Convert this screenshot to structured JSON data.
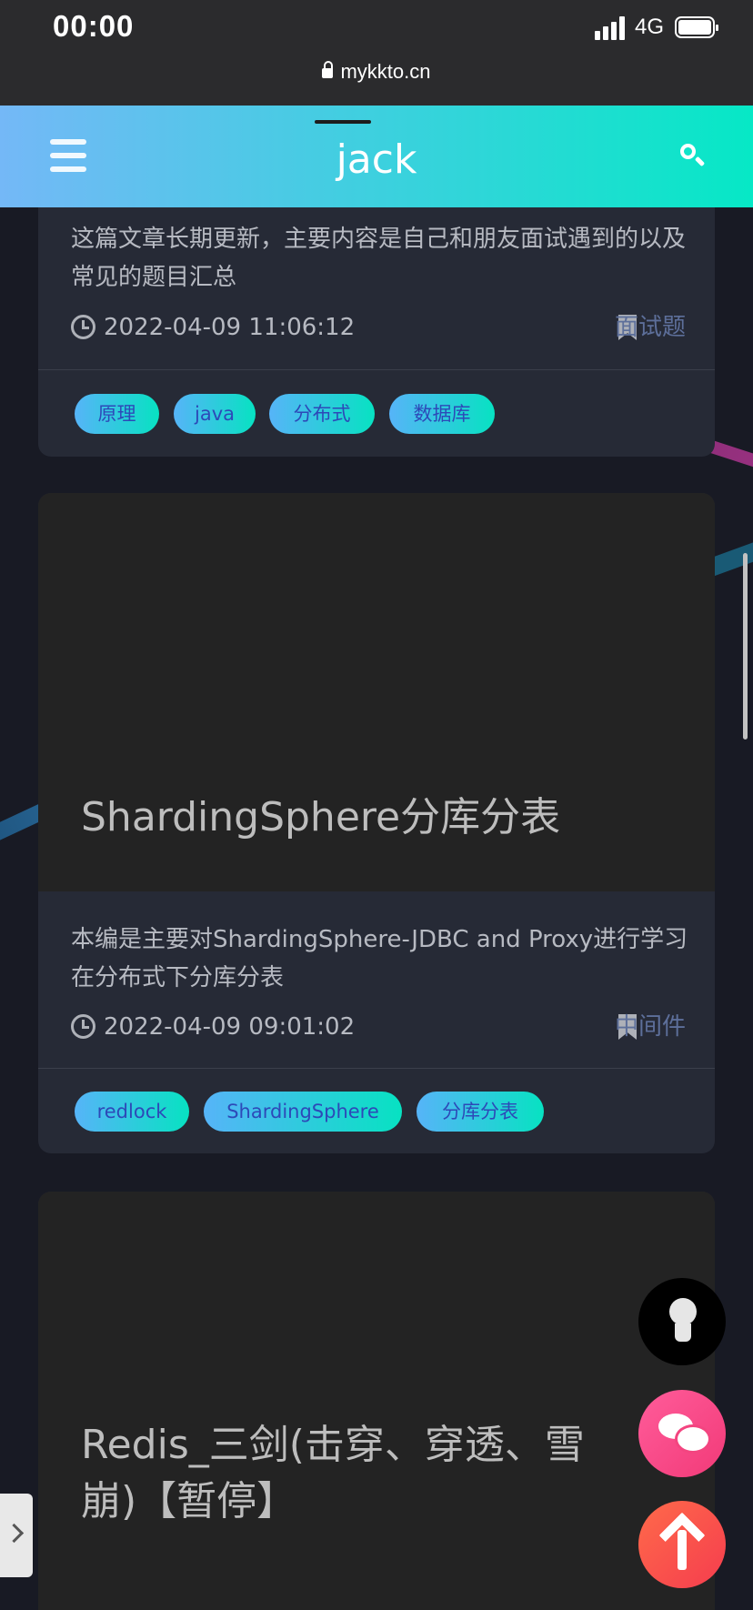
{
  "status_bar": {
    "time": "00:00",
    "network": "4G"
  },
  "browser": {
    "url": "mykkto.cn"
  },
  "header": {
    "brand": "jack"
  },
  "posts": [
    {
      "excerpt": "这篇文章长期更新，主要内容是自己和朋友面试遇到的以及常见的题目汇总",
      "date": "2022-04-09 11:06:12",
      "category": "面试题",
      "tags": [
        "原理",
        "java",
        "分布式",
        "数据库"
      ]
    },
    {
      "title": "ShardingSphere分库分表",
      "excerpt": "本编是主要对ShardingSphere-JDBC and Proxy进行学习在分布式下分库分表",
      "date": "2022-04-09 09:01:02",
      "category": "中间件",
      "tags": [
        "redlock",
        "ShardingSphere",
        "分库分表"
      ]
    },
    {
      "title": "Redis_三剑(击穿、穿透、雪崩)【暂停】"
    }
  ],
  "floating_buttons": {
    "theme": "lightbulb-icon",
    "chat": "chat-icon",
    "back_to_top": "arrow-up-icon"
  },
  "colors": {
    "header_gradient_start": "#74b8f7",
    "header_gradient_end": "#06e8c6",
    "card_bg": "#262a36",
    "category_text": "#5d6f9a",
    "tag_text": "#2d49b8"
  }
}
